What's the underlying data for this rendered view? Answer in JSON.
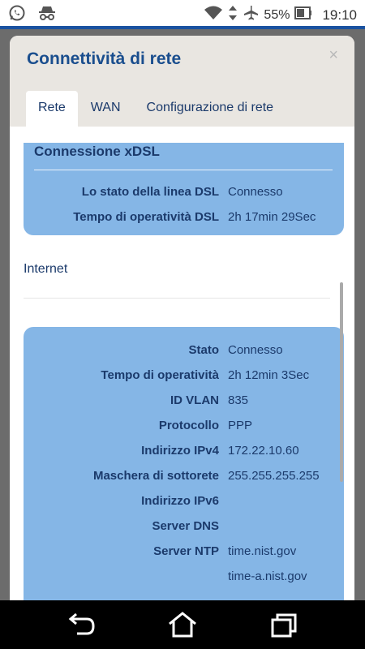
{
  "statusbar": {
    "battery_percent": "55%",
    "time": "19:10",
    "icons": [
      "whatsapp-icon",
      "incognito-icon",
      "wifi-icon",
      "data-arrows-icon",
      "airplane-icon",
      "battery-icon"
    ]
  },
  "dialog": {
    "title": "Connettività di rete",
    "close_label": "×"
  },
  "tabs": [
    {
      "label": "Rete",
      "active": true
    },
    {
      "label": "WAN",
      "active": false
    },
    {
      "label": "Configurazione di rete",
      "active": false
    }
  ],
  "xdsl": {
    "title": "Connessione xDSL",
    "rows": [
      {
        "label": "Lo stato della linea DSL",
        "value": "Connesso"
      },
      {
        "label": "Tempo di operatività DSL",
        "value": "2h 17min 29Sec"
      }
    ]
  },
  "internet": {
    "section_label": "Internet",
    "rows": [
      {
        "label": "Stato",
        "value": "Connesso"
      },
      {
        "label": "Tempo di operatività",
        "value": "2h 12min 3Sec"
      },
      {
        "label": "ID VLAN",
        "value": "835"
      },
      {
        "label": "Protocollo",
        "value": "PPP"
      },
      {
        "label": "Indirizzo IPv4",
        "value": "172.22.10.60"
      },
      {
        "label": "Maschera di sottorete",
        "value": "255.255.255.255"
      },
      {
        "label": "Indirizzo IPv6",
        "value": ""
      },
      {
        "label": "Server DNS",
        "value": ""
      },
      {
        "label": "Server NTP",
        "value": "time.nist.gov"
      },
      {
        "label": "",
        "value": "time-a.nist.gov"
      }
    ]
  },
  "colors": {
    "accent": "#1a52a0",
    "panel": "#85b6e6",
    "title_text": "#1a4e8e",
    "header_bg": "#e9e6e1"
  },
  "navbar": {
    "buttons": [
      "back-icon",
      "home-icon",
      "recents-icon"
    ]
  }
}
